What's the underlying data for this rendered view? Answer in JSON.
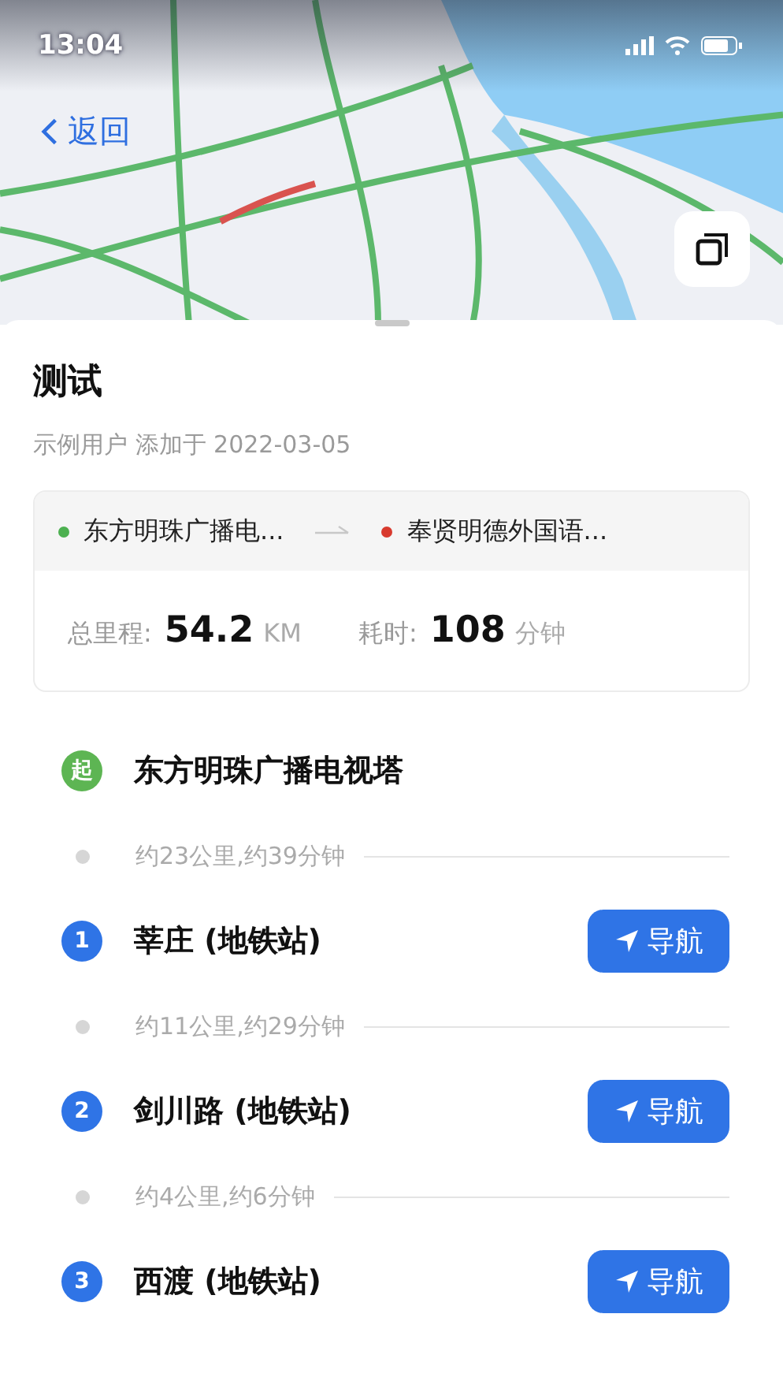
{
  "status_bar": {
    "time": "13:04"
  },
  "map": {
    "kind": "picture",
    "back_label": "返回"
  },
  "route": {
    "title": "测试",
    "meta": "示例用户 添加于 2022-03-05",
    "from": {
      "name": "东方明珠广播电...",
      "color": "#4cb050"
    },
    "to": {
      "name": "奉贤明德外国语...",
      "color": "#d83a2e"
    },
    "distance_label": "总里程:",
    "distance_value": "54.2",
    "distance_unit": "KM",
    "time_label": "耗时:",
    "time_value": "108",
    "time_unit": "分钟"
  },
  "steps": [
    {
      "kind": "start",
      "marker": "起",
      "name": "东方明珠广播电视塔"
    },
    {
      "kind": "segment",
      "text": "约23公里,约39分钟"
    },
    {
      "kind": "stop",
      "marker": "1",
      "name": "莘庄 (地铁站)",
      "button": "导航"
    },
    {
      "kind": "segment",
      "text": "约11公里,约29分钟"
    },
    {
      "kind": "stop",
      "marker": "2",
      "name": "剑川路 (地铁站)",
      "button": "导航"
    },
    {
      "kind": "segment",
      "text": "约4公里,约6分钟"
    },
    {
      "kind": "stop",
      "marker": "3",
      "name": "西渡 (地铁站)",
      "button": "导航"
    }
  ]
}
